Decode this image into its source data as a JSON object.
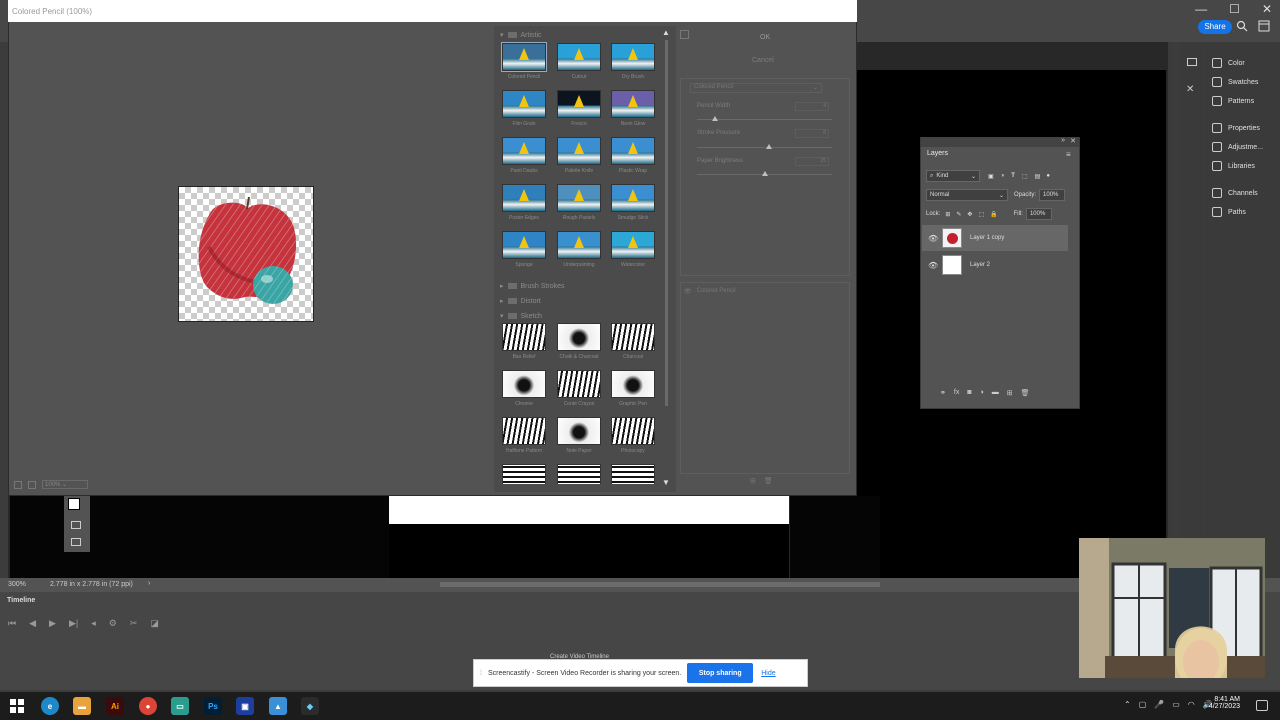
{
  "dialog": {
    "title": "Colored Pencil (100%)",
    "ok_label": "OK",
    "cancel_label": "Cancel",
    "zoom_value": "100%"
  },
  "gallery": {
    "categories": {
      "artistic": "Artistic",
      "brush_strokes": "Brush Strokes",
      "distort": "Distort",
      "sketch": "Sketch"
    },
    "artistic_filters": [
      "Colored Pencil",
      "Cutout",
      "Dry Brush",
      "Film Grain",
      "Fresco",
      "Neon Glow",
      "Paint Daubs",
      "Palette Knife",
      "Plastic Wrap",
      "Poster Edges",
      "Rough Pastels",
      "Smudge Stick",
      "Sponge",
      "Underpainting",
      "Watercolor"
    ],
    "sketch_filters": [
      "Bas Relief",
      "Chalk & Charcoal",
      "Charcoal",
      "Chrome",
      "Conté Crayon",
      "Graphic Pen",
      "Halftone Pattern",
      "Note Paper",
      "Photocopy"
    ]
  },
  "settings": {
    "filter_selected": "Colored Pencil",
    "sliders": [
      {
        "label": "Pencil Width",
        "value": 4
      },
      {
        "label": "Stroke Pressure",
        "value": 8
      },
      {
        "label": "Paper Brightness",
        "value": 25
      }
    ],
    "effect_layer": "Colored Pencil"
  },
  "photoshop": {
    "share_label": "Share",
    "right_panels": [
      "Color",
      "Swatches",
      "Patterns",
      "Properties",
      "Adjustme...",
      "Libraries",
      "Channels",
      "Paths"
    ],
    "status_zoom": "300%",
    "status_doc": "2.778 in x 2.778 in (72 ppi)",
    "timeline_title": "Timeline",
    "create_video_timeline": "Create Video Timeline"
  },
  "layers": {
    "tab_label": "Layers",
    "kind_label": "Kind",
    "blend_mode": "Normal",
    "opacity_label": "Opacity:",
    "opacity_value": "100%",
    "lock_label": "Lock:",
    "fill_label": "Fill:",
    "fill_value": "100%",
    "items": [
      {
        "name": "Layer 1 copy"
      },
      {
        "name": "Layer 2"
      }
    ]
  },
  "sharebar": {
    "message": "Screencastify - Screen Video Recorder is sharing your screen.",
    "stop_label": "Stop sharing",
    "hide_label": "Hide"
  },
  "taskbar": {
    "time": "8:41 AM",
    "date": "4/27/2023"
  },
  "colors": {
    "accent": "#1473e6",
    "share_blue": "#1a73e8"
  }
}
